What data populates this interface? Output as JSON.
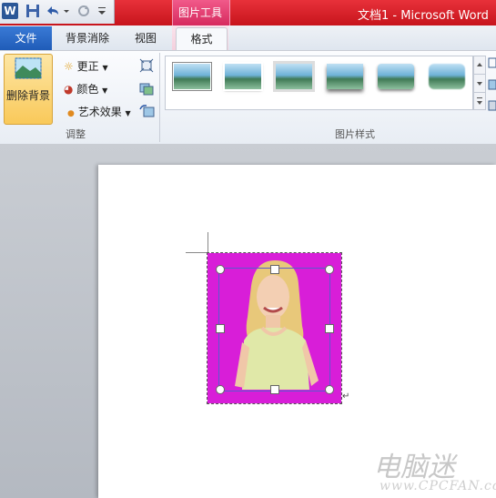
{
  "title_bar": {
    "context_tab_title": "图片工具",
    "document_title": "文档1 - Microsoft Word",
    "app_icon_letter": "W",
    "accent_red": "#d4202a",
    "accent_pink": "#e0386d"
  },
  "tabs": {
    "file": "文件",
    "remove_background": "背景消除",
    "view": "视图",
    "format": "格式"
  },
  "ribbon": {
    "remove_background_button": "删除背景",
    "corrections": "更正",
    "color": "颜色",
    "artistic_effects": "艺术效果",
    "adjust_group_label": "调整",
    "picture_styles_group_label": "图片样式",
    "style_thumbnail_count": 6
  },
  "document": {
    "paragraph_mark": "↵",
    "watermark": "电脑迷",
    "watermark_url": "www.CPCFAN.com",
    "picture_fill_color": "#d81ed8"
  }
}
